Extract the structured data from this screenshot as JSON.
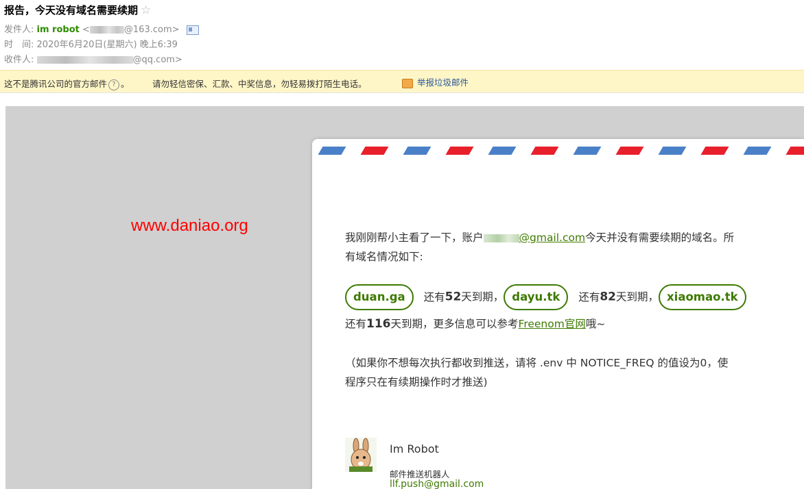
{
  "subject": "报告，今天没有域名需要续期",
  "header": {
    "from_label": "发件人:",
    "from_name": "im robot",
    "from_open": "<",
    "from_email_suffix": "@163.com>",
    "time_label": "时　间:",
    "time_value": "2020年6月20日(星期六) 晚上6:39",
    "to_label": "收件人:",
    "to_email_suffix": "@qq.com>"
  },
  "warning": {
    "text1": "这不是腾讯公司的官方邮件",
    "text1_end": "。",
    "text2": "请勿轻信密保、汇款、中奖信息，勿轻易拨打陌生电话。",
    "report_label": "举报垃圾邮件"
  },
  "watermark": "www.daniao.org",
  "body": {
    "line1_a": "我刚刚帮小主看了一下，账户",
    "account_email_suffix": "@gmail.com",
    "line1_b": "今天并没有需要续期的域名。所",
    "line2": "有域名情况如下:",
    "domains": [
      {
        "name": "duan.ga",
        "pre": "还有",
        "days": "52",
        "post": "天到期，"
      },
      {
        "name": "dayu.tk",
        "pre": "还有",
        "days": "82",
        "post": "天到期，"
      },
      {
        "name": "xiaomao.tk",
        "pre": "还有",
        "days": "116",
        "post": "天到期，更多信息可以参考"
      }
    ],
    "freenom_link": "Freenom官网",
    "end_text": "哦~",
    "note_line1": "（如果你不想每次执行都收到推送，请将 .env 中 NOTICE_FREQ 的值设为0，使",
    "note_line2": "程序只在有续期操作时才推送)"
  },
  "signature": {
    "name": "Im Robot",
    "role": "邮件推送机器人",
    "email": "llf.push@gmail.com"
  },
  "colors": {
    "sender_green": "#2f8c00",
    "link_green": "#3e7a00",
    "warning_bg": "#fff6c8",
    "canvas_gray": "#d0d0d0",
    "watermark_red": "#ff0000",
    "airmail_red": "#e8202c",
    "airmail_blue": "#4a80c8"
  }
}
